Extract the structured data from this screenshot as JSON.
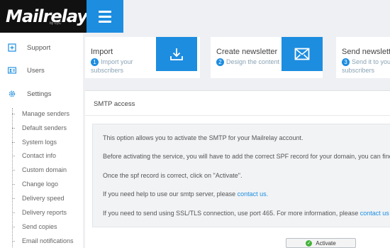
{
  "brand": {
    "logo_text": "Mailrelay",
    "logo_by": "by CyC"
  },
  "sidebar": {
    "items": [
      {
        "label": "Support",
        "icon": "plus-square-icon"
      },
      {
        "label": "Users",
        "icon": "user-card-icon"
      },
      {
        "label": "Settings",
        "icon": "gear-icon"
      }
    ],
    "sub_items": [
      "Manage senders",
      "Default senders",
      "System logs",
      "Contact info",
      "Custom domain",
      "Change logo",
      "Delivery speed",
      "Delivery reports",
      "Send copies",
      "Email notifications"
    ]
  },
  "cards": [
    {
      "title": "Import",
      "step": "1",
      "subtitle": "Import your subscribers",
      "icon": "download-icon"
    },
    {
      "title": "Create newsletter",
      "step": "2",
      "subtitle": "Design the content",
      "icon": "envelope-icon"
    },
    {
      "title": "Send newsletter",
      "step": "3",
      "subtitle": "Send it to your subscribers",
      "icon": "send-icon"
    }
  ],
  "smtp": {
    "header": "SMTP access",
    "line1": "This option allows you to activate the SMTP for your Mailrelay account.",
    "line2": "Before activating the service, you will have to add the correct SPF record for your domain, you can find",
    "line3": "Once the spf record is correct, click on \"Activate\".",
    "line4_text": "If you need help to use our smtp server, please ",
    "line4_link": "contact us.",
    "line5_text": "If you need to send using SSL/TLS connection, use port 465. For more information, please ",
    "line5_link": "contact us",
    "activate_label": "Activate"
  },
  "colors": {
    "accent": "#1d8de0",
    "topbar": "#111111",
    "success": "#43b33a"
  }
}
